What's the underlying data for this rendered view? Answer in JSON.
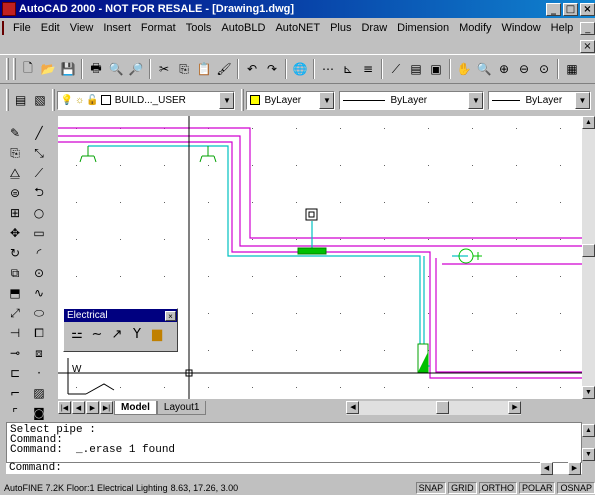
{
  "window": {
    "title": "AutoCAD 2000 - NOT FOR RESALE - [Drawing1.dwg]",
    "min": "_",
    "max": "□",
    "close": "×"
  },
  "menu": [
    "File",
    "Edit",
    "View",
    "Insert",
    "Format",
    "Tools",
    "AutoBLD",
    "AutoNET",
    "Plus",
    "Draw",
    "Dimension",
    "Modify",
    "Window",
    "Help"
  ],
  "mdi": {
    "min": "_",
    "restore": "❐",
    "close": "×"
  },
  "toolbar_std": {
    "icons": [
      {
        "name": "new-icon",
        "glyph": "🗋"
      },
      {
        "name": "open-icon",
        "glyph": "📂"
      },
      {
        "name": "save-icon",
        "glyph": "💾"
      },
      {
        "name": "sep"
      },
      {
        "name": "print-icon",
        "glyph": "🖶"
      },
      {
        "name": "preview-icon",
        "glyph": "🔍"
      },
      {
        "name": "find-icon",
        "glyph": "🔎"
      },
      {
        "name": "sep"
      },
      {
        "name": "cut-icon",
        "glyph": "✂"
      },
      {
        "name": "copy-icon",
        "glyph": "⎘"
      },
      {
        "name": "paste-icon",
        "glyph": "📋"
      },
      {
        "name": "matchprop-icon",
        "glyph": "🖌"
      },
      {
        "name": "sep"
      },
      {
        "name": "undo-icon",
        "glyph": "↶"
      },
      {
        "name": "redo-icon",
        "glyph": "↷"
      },
      {
        "name": "sep"
      },
      {
        "name": "hyperlink-icon",
        "glyph": "🌐"
      },
      {
        "name": "sep"
      },
      {
        "name": "snap-icon",
        "glyph": "⋯"
      },
      {
        "name": "ucs-icon",
        "glyph": "⊾"
      },
      {
        "name": "tracking-icon",
        "glyph": "≡"
      },
      {
        "name": "sep"
      },
      {
        "name": "inquiry-icon",
        "glyph": "⟋"
      },
      {
        "name": "properties-icon",
        "glyph": "▤"
      },
      {
        "name": "designcenter-icon",
        "glyph": "▣"
      },
      {
        "name": "sep"
      },
      {
        "name": "pan-icon",
        "glyph": "✋"
      },
      {
        "name": "zoom-realtime-icon",
        "glyph": "🔍"
      },
      {
        "name": "zoom-window-icon",
        "glyph": "⊕"
      },
      {
        "name": "zoom-previous-icon",
        "glyph": "⊖"
      },
      {
        "name": "zoom-extents-icon",
        "glyph": "⊙"
      },
      {
        "name": "sep"
      },
      {
        "name": "help-icon",
        "glyph": "▦"
      }
    ]
  },
  "layers": {
    "layer_name": "BUILD..._USER",
    "color": "ByLayer",
    "linetype": "ByLayer",
    "lineweight": "ByLayer",
    "dropdown_arrow": "▼"
  },
  "palette": {
    "title": "Electrical",
    "close": "×"
  },
  "tabs": {
    "nav": [
      "|◀",
      "◀",
      "▶",
      "▶|"
    ],
    "items": [
      "Model",
      "Layout1"
    ]
  },
  "command": {
    "lines": [
      "Select pipe :",
      "Command:",
      "Command:  _.erase 1 found"
    ],
    "prompt": "Command:"
  },
  "status": {
    "text": "AutoFINE 7.2K Floor:1 Electrical Lighting",
    "coords": "8.63, 17.26, 3.00",
    "toggles": [
      "SNAP",
      "GRID",
      "ORTHO",
      "POLAR",
      "OSNAP"
    ]
  },
  "colors": {
    "title_bar": "#000080",
    "wire_magenta": "#d000d0",
    "pipe_cyan": "#00c0c0",
    "fixture_green": "#00c000"
  }
}
